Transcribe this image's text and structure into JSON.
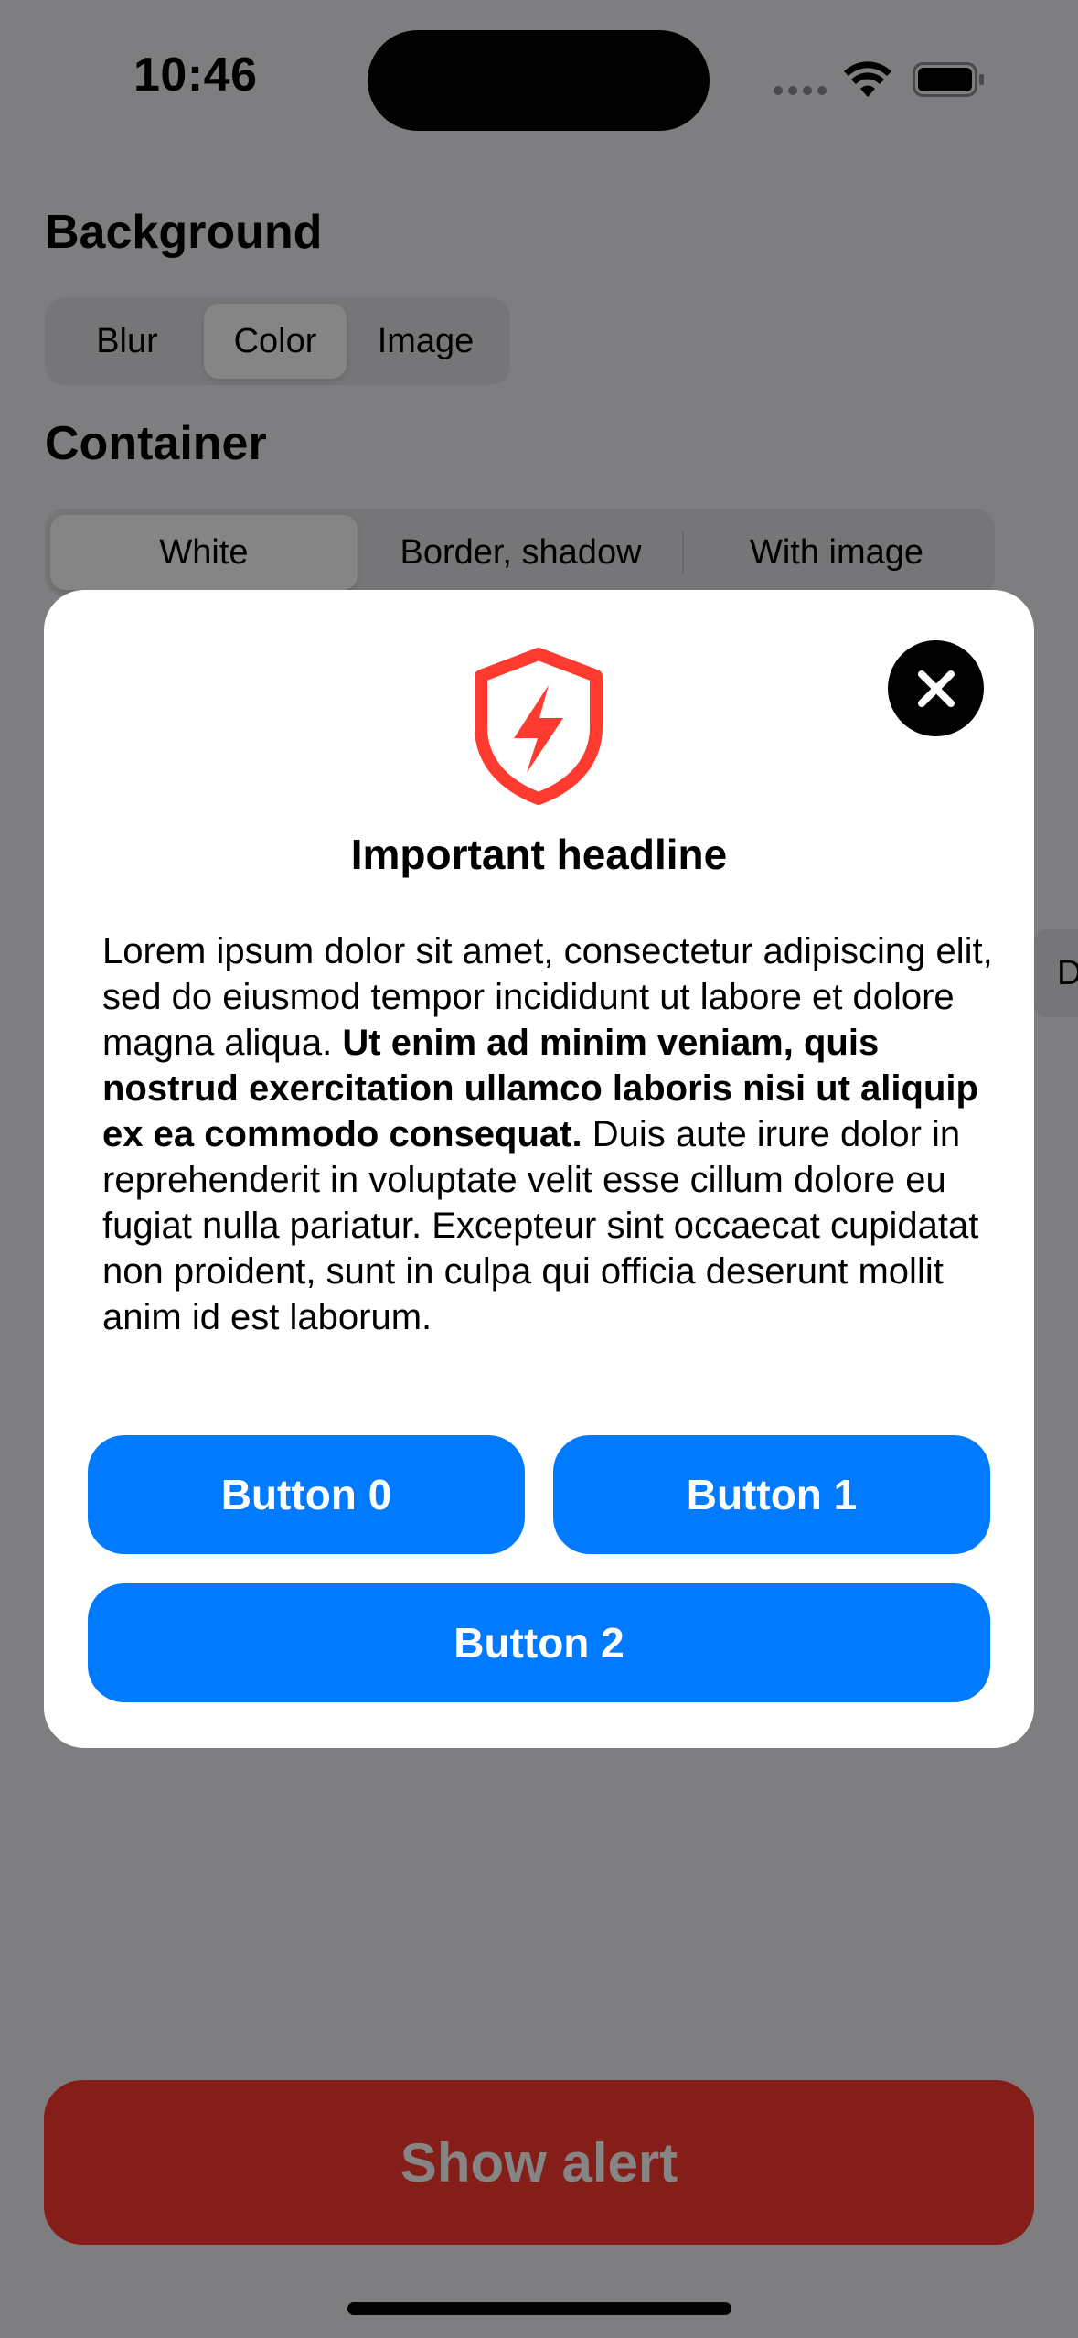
{
  "status_bar": {
    "time": "10:46"
  },
  "background_section": {
    "title": "Background",
    "options": [
      "Blur",
      "Color",
      "Image"
    ],
    "selected": "Color"
  },
  "container_section": {
    "title": "Container",
    "options": [
      "White",
      "Border, shadow",
      "With image"
    ],
    "selected": "White"
  },
  "side_chip": {
    "label": "D"
  },
  "alert": {
    "icon": "shield-bolt-icon",
    "icon_color": "#ff3b30",
    "headline": "Important headline",
    "body_intro": "Lorem ipsum dolor sit amet, consectetur adipiscing elit, sed do eiusmod tempor incididunt ut labore et dolore magna aliqua. ",
    "body_bold": "Ut enim ad minim veniam, quis nostrud exercitation ullamco laboris nisi ut aliquip ex ea commodo consequat.",
    "body_outro": " Duis aute irure dolor in reprehenderit in voluptate velit esse cillum dolore eu fugiat nulla pariatur. Excepteur sint occaecat cupidatat non proident, sunt in culpa qui officia deserunt mollit anim id est laborum.",
    "buttons": [
      "Button 0",
      "Button 1",
      "Button 2"
    ],
    "button_color": "#007aff",
    "close_icon": "close-icon"
  },
  "show_alert_button": {
    "label": "Show alert",
    "color": "#ff3b30"
  }
}
